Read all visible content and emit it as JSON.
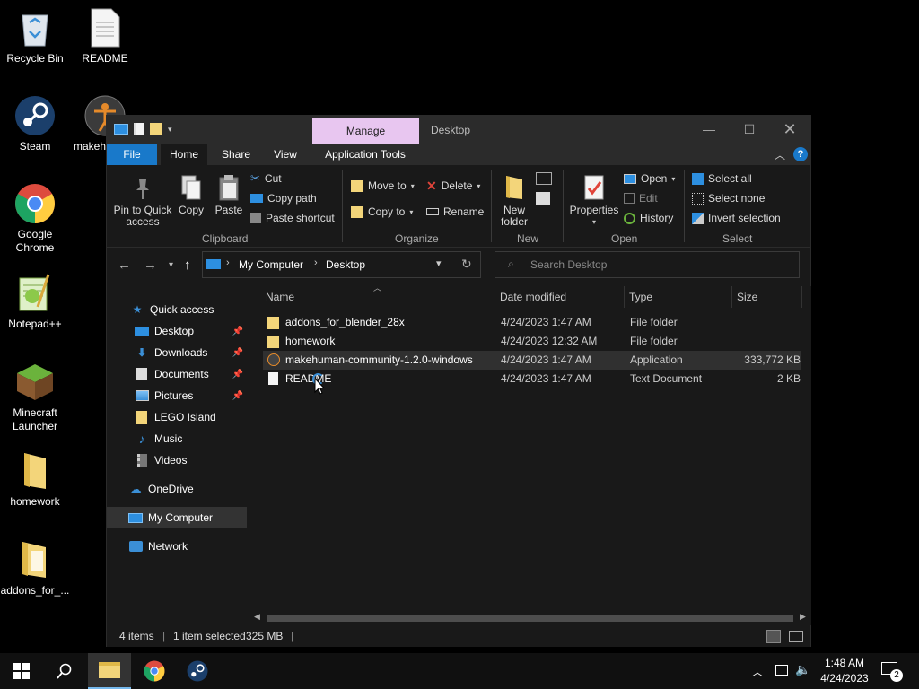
{
  "desktop": {
    "icons": [
      {
        "label": "Recycle Bin"
      },
      {
        "label": "README"
      },
      {
        "label": "Steam"
      },
      {
        "label": "makeh"
      },
      {
        "label": "Google Chrome"
      },
      {
        "label": "Notepad++"
      },
      {
        "label": "Minecraft Launcher"
      },
      {
        "label": "homework"
      },
      {
        "label": "addons_for_..."
      }
    ]
  },
  "window": {
    "title": "Desktop",
    "context_tab": "Manage",
    "tabs": [
      "File",
      "Home",
      "Share",
      "View",
      "Application Tools"
    ],
    "ribbon": {
      "clipboard": {
        "label": "Clipboard",
        "pin": "Pin to Quick access",
        "copy": "Copy",
        "paste": "Paste",
        "cut": "Cut",
        "copy_path": "Copy path",
        "paste_shortcut": "Paste shortcut"
      },
      "organize": {
        "label": "Organize",
        "move_to": "Move to",
        "copy_to": "Copy to",
        "delete": "Delete",
        "rename": "Rename"
      },
      "new": {
        "label": "New",
        "new_folder": "New folder"
      },
      "open": {
        "label": "Open",
        "properties": "Properties",
        "open": "Open",
        "edit": "Edit",
        "history": "History"
      },
      "select": {
        "label": "Select",
        "select_all": "Select all",
        "select_none": "Select none",
        "invert": "Invert selection"
      }
    },
    "address": {
      "root": "My Computer",
      "current": "Desktop"
    },
    "search": {
      "placeholder": "Search Desktop"
    },
    "nav_pane": {
      "quick_access": "Quick access",
      "items": [
        "Desktop",
        "Downloads",
        "Documents",
        "Pictures",
        "LEGO Island",
        "Music",
        "Videos"
      ],
      "onedrive": "OneDrive",
      "my_computer": "My Computer",
      "network": "Network"
    },
    "columns": {
      "name": "Name",
      "date": "Date modified",
      "type": "Type",
      "size": "Size"
    },
    "files": [
      {
        "name": "addons_for_blender_28x",
        "date": "4/24/2023 1:47 AM",
        "type": "File folder",
        "size": ""
      },
      {
        "name": "homework",
        "date": "4/24/2023 12:32 AM",
        "type": "File folder",
        "size": ""
      },
      {
        "name": "makehuman-community-1.2.0-windows",
        "date": "4/24/2023 1:47 AM",
        "type": "Application",
        "size": "333,772 KB"
      },
      {
        "name": "README",
        "date": "4/24/2023 1:47 AM",
        "type": "Text Document",
        "size": "2 KB"
      }
    ],
    "status": {
      "items": "4 items",
      "selected": "1 item selected",
      "size": "325 MB"
    }
  },
  "taskbar": {
    "time": "1:48 AM",
    "date": "4/24/2023",
    "notifications": "2"
  },
  "colors": {
    "accent": "#1979ca",
    "manage_tab": "#e8c6f0",
    "background": "#191919"
  }
}
